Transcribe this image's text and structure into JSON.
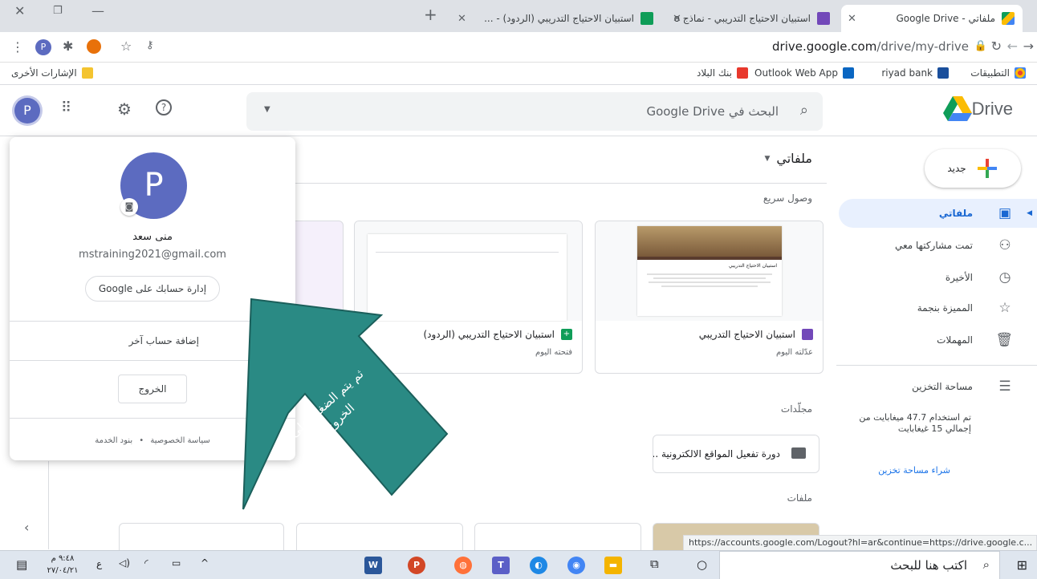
{
  "browser": {
    "tabs": [
      {
        "title": "ملفاتي - Google Drive",
        "active": true
      },
      {
        "title": "استبيان الاحتياج التدريبي - نماذج Goo",
        "active": false
      },
      {
        "title": "استبيان الاحتياج التدريبي (الردود) - ...",
        "active": false
      }
    ],
    "new_tab_label": "+",
    "url_host": "drive.google.com",
    "url_path": "/drive/my-drive",
    "profile_initial": "P",
    "bookmarks": [
      {
        "label": "التطبيقات",
        "color": "#ea4335"
      },
      {
        "label": "riyad bank",
        "color": "#1a4f9c"
      },
      {
        "label": "Outlook Web App",
        "color": "#0a66c2"
      },
      {
        "label": "بنك البلاد",
        "color": "#e8382c"
      }
    ],
    "other_bookmarks": "الإشارات الأخرى"
  },
  "drive": {
    "logo_text": "Drive",
    "search_placeholder": "البحث في Google Drive",
    "new_button": "جديد",
    "nav": [
      {
        "label": "ملفاتي",
        "icon": "my-drive-icon",
        "glyph": "▣",
        "active": true
      },
      {
        "label": "تمت مشاركتها معي",
        "icon": "shared-icon",
        "glyph": "👥",
        "active": false
      },
      {
        "label": "الأخيرة",
        "icon": "clock-icon",
        "glyph": "◷",
        "active": false
      },
      {
        "label": "المميزة بنجمة",
        "icon": "star-icon",
        "glyph": "☆",
        "active": false
      },
      {
        "label": "المهملات",
        "icon": "trash-icon",
        "glyph": "🗑",
        "active": false
      }
    ],
    "storage_label": "مساحة التخزين",
    "storage_usage": "تم استخدام 47.7 ميغابايت من إجمالي 15 غيغابايت",
    "buy_storage": "شراء مساحة تخزين",
    "page_title": "ملفاتي",
    "quick_access": "وصول سريع",
    "quick_files": [
      {
        "name": "استبيان الاحتياج التدريبي",
        "sub": "عدّلته اليوم",
        "icon_color": "#7248b9",
        "thumb_title": "استبيان الاحتياج التدريبي"
      },
      {
        "name": "استبيان الاحتياج التدريبي (الردود)",
        "sub": "فتحته اليوم",
        "icon_color": "#0f9d58"
      }
    ],
    "folders_label": "مجلّدات",
    "folders": [
      {
        "name": "دورة تفعيل المواقع الالكترونية ..."
      }
    ],
    "files_label": "ملفات"
  },
  "account": {
    "initial": "P",
    "name": "منى سعد",
    "email": "mstraining2021@gmail.com",
    "manage_button": "إدارة حسابك على Google",
    "add_account": "إضافة حساب آخر",
    "signout_button": "الخروج",
    "privacy": "سياسة الخصوصية",
    "terms": "بنود الخدمة",
    "dot": "•"
  },
  "annotation": {
    "text": "ثم يتم الضغط على الخروج",
    "color": "#2a8a84"
  },
  "status_url": "https://accounts.google.com/Logout?hl=ar&continue=https://drive.google.c...",
  "taskbar": {
    "search_text": "اكتب هنا للبحث",
    "time": "٩:٤٨ م",
    "date": "٢٧/٠٤/٢١",
    "lang": "ع"
  }
}
